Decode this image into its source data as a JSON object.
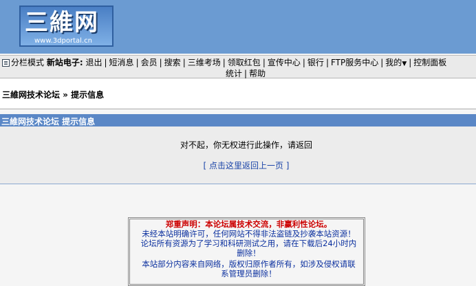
{
  "header": {
    "logo_text": "三維网",
    "logo_url": "www.3dportal.cn"
  },
  "nav": {
    "mode": "分栏模式",
    "user_label": "新站电子:",
    "items": [
      "退出",
      "短消息",
      "会员",
      "搜索",
      "三维考场",
      "领取红包",
      "宣传中心",
      "银行",
      "FTP服务中心",
      "我的",
      "控制面板"
    ],
    "row2": [
      "统计",
      "帮助"
    ]
  },
  "breadcrumb": {
    "text": "三維网技术论坛 » 提示信息"
  },
  "panel": {
    "title": "三維网技术论坛 提示信息",
    "message": "对不起，你无权进行此操作，请返回",
    "back_link": "[ 点击这里返回上一页 ]"
  },
  "notice": {
    "heading": "郑重声明：本论坛属技术交流，非赢利性论坛。",
    "line1": "未经本站明确许可，任何网站不得非法盗链及抄袭本站资源！",
    "line2": "论坛所有资源为了学习和科研测试之用，请在下载后24小时内",
    "line3": "删除！",
    "line4": "本站部分内容来自网络，版权归原作者所有，如涉及侵权请联",
    "line5": "系管理员删除！"
  }
}
